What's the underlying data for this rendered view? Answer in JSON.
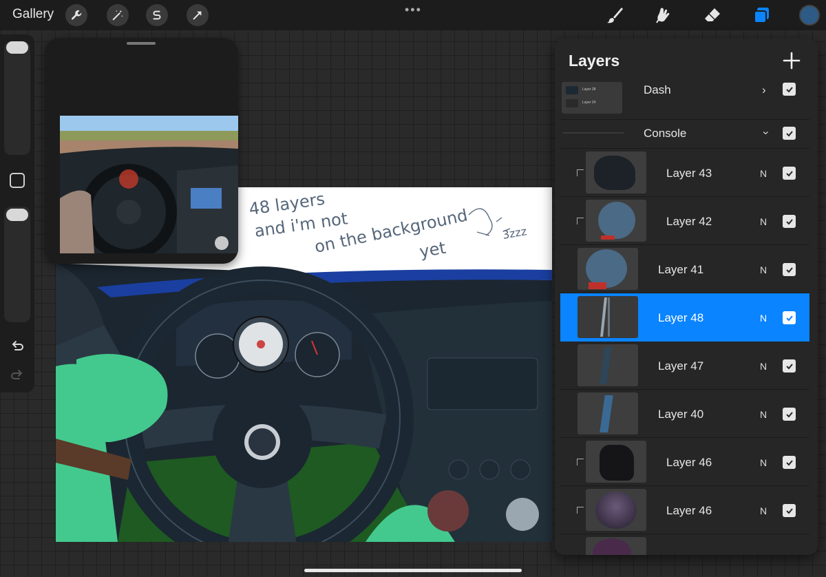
{
  "topbar": {
    "gallery_label": "Gallery",
    "left_tools": [
      "wrench-icon",
      "magic-wand-icon",
      "selection-icon",
      "transform-arrow-icon"
    ],
    "more_label": "•••",
    "right_tools": [
      "brush-icon",
      "smudge-icon",
      "eraser-icon",
      "layers-icon"
    ],
    "current_color": "#2e5a86",
    "active_tool_color": "#0a84ff"
  },
  "canvas": {
    "handwritten_lines": [
      "48 layers",
      "and i'm not",
      "on the background",
      "yet",
      "3zzz"
    ]
  },
  "layers_panel": {
    "title": "Layers",
    "add_label": "+",
    "groups": [
      {
        "name": "Dash",
        "expanded": false,
        "visible": true,
        "preview_labels": [
          "Layer 28",
          "Layer 24"
        ]
      },
      {
        "name": "Console",
        "expanded": true,
        "visible": true
      }
    ],
    "layers": [
      {
        "name": "Layer 43",
        "blend": "N",
        "visible": true,
        "clipped": true,
        "selected": false
      },
      {
        "name": "Layer 42",
        "blend": "N",
        "visible": true,
        "clipped": true,
        "selected": false
      },
      {
        "name": "Layer 41",
        "blend": "N",
        "visible": true,
        "clipped": false,
        "selected": false
      },
      {
        "name": "Layer 48",
        "blend": "N",
        "visible": true,
        "clipped": false,
        "selected": true
      },
      {
        "name": "Layer 47",
        "blend": "N",
        "visible": true,
        "clipped": false,
        "selected": false
      },
      {
        "name": "Layer 40",
        "blend": "N",
        "visible": true,
        "clipped": false,
        "selected": false
      },
      {
        "name": "Layer 46",
        "blend": "N",
        "visible": true,
        "clipped": true,
        "selected": false
      },
      {
        "name": "Layer 46",
        "blend": "N",
        "visible": true,
        "clipped": true,
        "selected": false
      }
    ]
  }
}
